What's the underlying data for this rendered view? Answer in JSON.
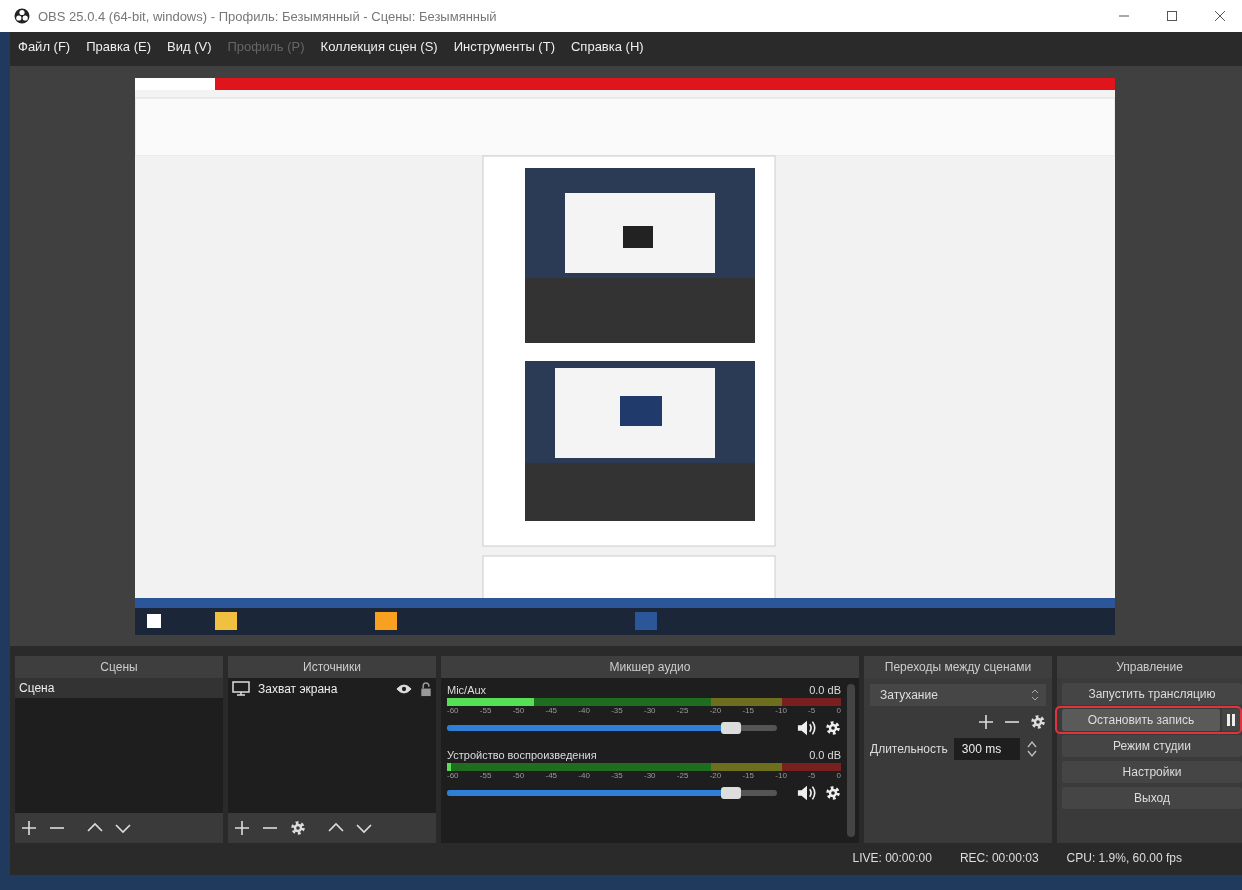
{
  "window": {
    "title": "OBS 25.0.4 (64-bit, windows) - Профиль: Безымянный - Сцены: Безымянный"
  },
  "menu": [
    {
      "label": "Файл (F)",
      "disabled": false
    },
    {
      "label": "Правка (E)",
      "disabled": false
    },
    {
      "label": "Вид (V)",
      "disabled": false
    },
    {
      "label": "Профиль (P)",
      "disabled": true
    },
    {
      "label": "Коллекция сцен (S)",
      "disabled": false
    },
    {
      "label": "Инструменты (T)",
      "disabled": false
    },
    {
      "label": "Справка (H)",
      "disabled": false
    }
  ],
  "scenes": {
    "title": "Сцены",
    "items": [
      {
        "name": "Сцена",
        "selected": true
      }
    ]
  },
  "sources": {
    "title": "Источники",
    "items": [
      {
        "name": "Захват экрана",
        "selected": false,
        "visible": true,
        "locked": false
      }
    ]
  },
  "mixer": {
    "title": "Микшер аудио",
    "channels": [
      {
        "name": "Mic/Aux",
        "reading": "0.0 dB",
        "meter": {
          "level": 0.22
        },
        "level": 0.86,
        "scale": [
          "-60",
          "-55",
          "-50",
          "-45",
          "-40",
          "-35",
          "-30",
          "-25",
          "-20",
          "-15",
          "-10",
          "-5",
          "0"
        ]
      },
      {
        "name": "Устройство воспроизведения",
        "reading": "0.0 dB",
        "meter": {
          "level": 0.01
        },
        "level": 0.86,
        "scale": [
          "-60",
          "-55",
          "-50",
          "-45",
          "-40",
          "-35",
          "-30",
          "-25",
          "-20",
          "-15",
          "-10",
          "-5",
          "0"
        ]
      }
    ]
  },
  "transitions": {
    "title": "Переходы между сценами",
    "select": {
      "value": "Затухание"
    },
    "duration": {
      "label": "Длительность",
      "value": "300 ms"
    }
  },
  "controls": {
    "title": "Управление",
    "buttons": [
      {
        "label": "Запустить трансляцию",
        "highlighted": false,
        "pause": false
      },
      {
        "label": "Остановить запись",
        "highlighted": true,
        "pause": true
      },
      {
        "label": "Режим студии",
        "highlighted": false,
        "pause": false
      },
      {
        "label": "Настройки",
        "highlighted": false,
        "pause": false
      },
      {
        "label": "Выход",
        "highlighted": false,
        "pause": false
      }
    ]
  },
  "status_bar": [
    "LIVE: 00:00:00",
    "REC: 00:00:03",
    "CPU: 1.9%, 60.00 fps"
  ]
}
